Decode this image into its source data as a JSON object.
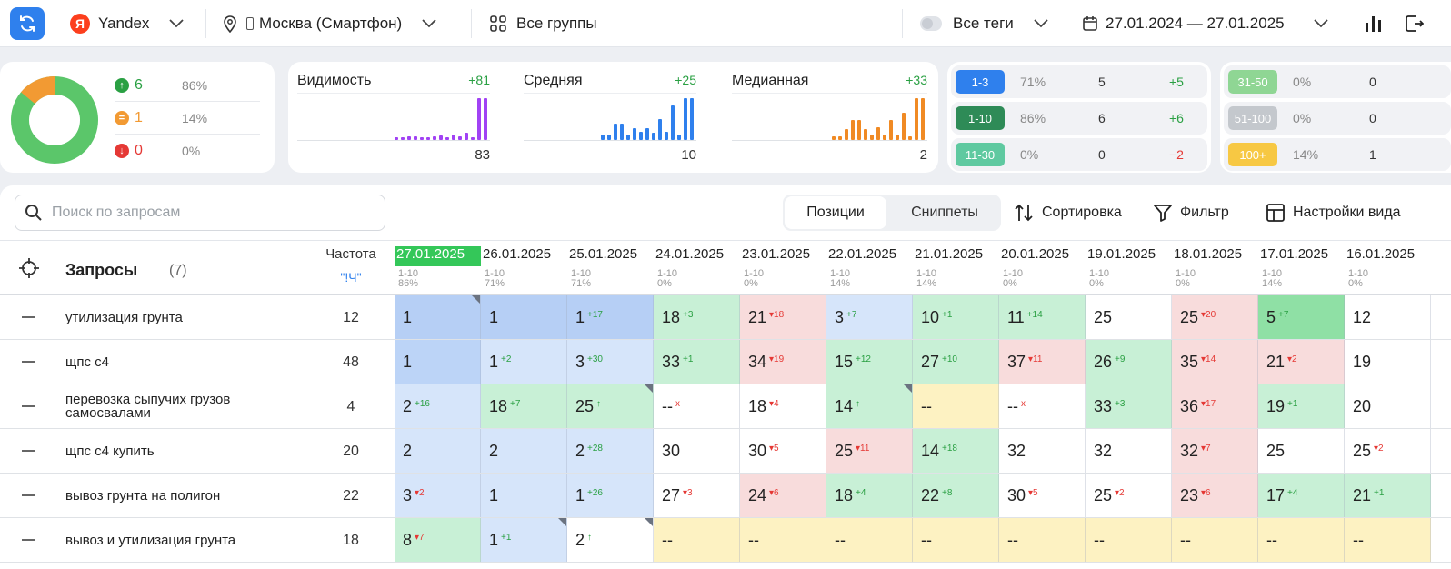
{
  "topbar": {
    "engine": "Yandex",
    "region": "Москва (Смартфон)",
    "groups": "Все группы",
    "tags": "Все теги",
    "date_range": "27.01.2024 — 27.01.2025"
  },
  "summary": {
    "up": {
      "count": "6",
      "pct": "86%"
    },
    "same": {
      "count": "1",
      "pct": "14%"
    },
    "down": {
      "count": "0",
      "pct": "0%"
    },
    "donut": {
      "green_fraction": 0.86,
      "orange_fraction": 0.14
    }
  },
  "metrics": [
    {
      "title": "Видимость",
      "delta": "+81",
      "value": "83",
      "color": "#a142f4",
      "bars": [
        3,
        3,
        4,
        4,
        3,
        3,
        4,
        5,
        3,
        6,
        4,
        8,
        3,
        46,
        46
      ]
    },
    {
      "title": "Средняя",
      "delta": "+25",
      "value": "10",
      "color": "#2f80ed",
      "bars": [
        5,
        5,
        14,
        14,
        5,
        10,
        7,
        10,
        6,
        18,
        7,
        30,
        5,
        36,
        36
      ]
    },
    {
      "title": "Медианная",
      "delta": "+33",
      "value": "2",
      "color": "#f08a24",
      "bars": [
        4,
        4,
        12,
        22,
        22,
        12,
        6,
        14,
        6,
        22,
        6,
        30,
        4,
        46,
        46
      ]
    }
  ],
  "ranges": [
    {
      "label": "1-3",
      "pct": "71%",
      "count": "5",
      "delta": "+5",
      "color": "#2f80ed",
      "delta_color": "#2aa043"
    },
    {
      "label": "1-10",
      "pct": "86%",
      "count": "6",
      "delta": "+6",
      "color": "#2e8b57",
      "delta_color": "#2aa043"
    },
    {
      "label": "11-30",
      "pct": "0%",
      "count": "0",
      "delta": "−2",
      "color": "#5fc9a0",
      "delta_color": "#e53935"
    },
    {
      "label": "31-50",
      "pct": "0%",
      "count": "0",
      "delta": "",
      "color": "#8fd694",
      "delta_color": "#2aa043"
    },
    {
      "label": "51-100",
      "pct": "0%",
      "count": "0",
      "delta": "",
      "color": "#c4c8cd",
      "delta_color": "#2aa043"
    },
    {
      "label": "100+",
      "pct": "14%",
      "count": "1",
      "delta": "",
      "color": "#f7c843",
      "delta_color": "#2aa043"
    }
  ],
  "toolbar": {
    "search_placeholder": "Поиск по запросам",
    "tab_positions": "Позиции",
    "tab_snippets": "Сниппеты",
    "sort": "Сортировка",
    "filter": "Фильтр",
    "view_settings": "Настройки вида"
  },
  "table": {
    "queries_header": "Запросы",
    "queries_count": "(7)",
    "freq_header": "Частота",
    "freq_sub": "\"!Ч\"",
    "dates": [
      {
        "date": "27.01.2025",
        "range": "1-10",
        "pct": "86%"
      },
      {
        "date": "26.01.2025",
        "range": "1-10",
        "pct": "71%"
      },
      {
        "date": "25.01.2025",
        "range": "1-10",
        "pct": "71%"
      },
      {
        "date": "24.01.2025",
        "range": "1-10",
        "pct": "0%"
      },
      {
        "date": "23.01.2025",
        "range": "1-10",
        "pct": "0%"
      },
      {
        "date": "22.01.2025",
        "range": "1-10",
        "pct": "14%"
      },
      {
        "date": "21.01.2025",
        "range": "1-10",
        "pct": "14%"
      },
      {
        "date": "20.01.2025",
        "range": "1-10",
        "pct": "0%"
      },
      {
        "date": "19.01.2025",
        "range": "1-10",
        "pct": "0%"
      },
      {
        "date": "18.01.2025",
        "range": "1-10",
        "pct": "0%"
      },
      {
        "date": "17.01.2025",
        "range": "1-10",
        "pct": "14%"
      },
      {
        "date": "16.01.2025",
        "range": "1-10",
        "pct": "0%"
      }
    ],
    "rows": [
      {
        "query": "утилизация грунта",
        "freq": "12",
        "cells": [
          {
            "v": "1",
            "s": "",
            "t": "",
            "c": "c-blue1",
            "k": 1
          },
          {
            "v": "1",
            "s": "",
            "t": "",
            "c": "c-blue1",
            "k": 0
          },
          {
            "v": "1",
            "s": "+17",
            "t": "g",
            "c": "c-blue1",
            "k": 0
          },
          {
            "v": "18",
            "s": "+3",
            "t": "g",
            "c": "c-green",
            "k": 0
          },
          {
            "v": "21",
            "s": "▾18",
            "t": "r",
            "c": "c-red",
            "k": 0
          },
          {
            "v": "3",
            "s": "+7",
            "t": "g",
            "c": "c-lblue",
            "k": 0
          },
          {
            "v": "10",
            "s": "+1",
            "t": "g",
            "c": "c-green",
            "k": 0
          },
          {
            "v": "11",
            "s": "+14",
            "t": "g",
            "c": "c-green",
            "k": 0
          },
          {
            "v": "25",
            "s": "",
            "t": "",
            "c": "c-white",
            "k": 0
          },
          {
            "v": "25",
            "s": "▾20",
            "t": "r",
            "c": "c-red",
            "k": 0
          },
          {
            "v": "5",
            "s": "+7",
            "t": "g",
            "c": "c-green2",
            "k": 0
          },
          {
            "v": "12",
            "s": "",
            "t": "",
            "c": "c-white",
            "k": 0
          }
        ]
      },
      {
        "query": "щпс с4",
        "freq": "48",
        "cells": [
          {
            "v": "1",
            "s": "",
            "t": "",
            "c": "c-blue",
            "k": 0
          },
          {
            "v": "1",
            "s": "+2",
            "t": "g",
            "c": "c-lblue",
            "k": 0
          },
          {
            "v": "3",
            "s": "+30",
            "t": "g",
            "c": "c-lblue",
            "k": 0
          },
          {
            "v": "33",
            "s": "+1",
            "t": "g",
            "c": "c-green",
            "k": 0
          },
          {
            "v": "34",
            "s": "▾19",
            "t": "r",
            "c": "c-red",
            "k": 0
          },
          {
            "v": "15",
            "s": "+12",
            "t": "g",
            "c": "c-green",
            "k": 0
          },
          {
            "v": "27",
            "s": "+10",
            "t": "g",
            "c": "c-green",
            "k": 0
          },
          {
            "v": "37",
            "s": "▾11",
            "t": "r",
            "c": "c-red",
            "k": 0
          },
          {
            "v": "26",
            "s": "+9",
            "t": "g",
            "c": "c-green",
            "k": 0
          },
          {
            "v": "35",
            "s": "▾14",
            "t": "r",
            "c": "c-red",
            "k": 0
          },
          {
            "v": "21",
            "s": "▾2",
            "t": "r",
            "c": "c-red",
            "k": 0
          },
          {
            "v": "19",
            "s": "",
            "t": "",
            "c": "c-white",
            "k": 0
          }
        ]
      },
      {
        "query": "перевозка сыпучих грузов самосвалами",
        "freq": "4",
        "cells": [
          {
            "v": "2",
            "s": "+16",
            "t": "g",
            "c": "c-lblue",
            "k": 0
          },
          {
            "v": "18",
            "s": "+7",
            "t": "g",
            "c": "c-green",
            "k": 0
          },
          {
            "v": "25",
            "s": "↑",
            "t": "g",
            "c": "c-green",
            "k": 1
          },
          {
            "v": "--",
            "s": "x",
            "t": "r",
            "c": "c-white",
            "k": 0
          },
          {
            "v": "18",
            "s": "▾4",
            "t": "r",
            "c": "c-white",
            "k": 0
          },
          {
            "v": "14",
            "s": "↑",
            "t": "g",
            "c": "c-green",
            "k": 1
          },
          {
            "v": "--",
            "s": "",
            "t": "",
            "c": "c-yellow",
            "k": 0
          },
          {
            "v": "--",
            "s": "x",
            "t": "r",
            "c": "c-white",
            "k": 0
          },
          {
            "v": "33",
            "s": "+3",
            "t": "g",
            "c": "c-green",
            "k": 0
          },
          {
            "v": "36",
            "s": "▾17",
            "t": "r",
            "c": "c-red",
            "k": 0
          },
          {
            "v": "19",
            "s": "+1",
            "t": "g",
            "c": "c-green",
            "k": 0
          },
          {
            "v": "20",
            "s": "",
            "t": "",
            "c": "c-white",
            "k": 0
          }
        ]
      },
      {
        "query": "щпс с4 купить",
        "freq": "20",
        "cells": [
          {
            "v": "2",
            "s": "",
            "t": "",
            "c": "c-lblue",
            "k": 0
          },
          {
            "v": "2",
            "s": "",
            "t": "",
            "c": "c-lblue",
            "k": 0
          },
          {
            "v": "2",
            "s": "+28",
            "t": "g",
            "c": "c-lblue",
            "k": 0
          },
          {
            "v": "30",
            "s": "",
            "t": "",
            "c": "c-white",
            "k": 0
          },
          {
            "v": "30",
            "s": "▾5",
            "t": "r",
            "c": "c-white",
            "k": 0
          },
          {
            "v": "25",
            "s": "▾11",
            "t": "r",
            "c": "c-red",
            "k": 0
          },
          {
            "v": "14",
            "s": "+18",
            "t": "g",
            "c": "c-green",
            "k": 0
          },
          {
            "v": "32",
            "s": "",
            "t": "",
            "c": "c-white",
            "k": 0
          },
          {
            "v": "32",
            "s": "",
            "t": "",
            "c": "c-white",
            "k": 0
          },
          {
            "v": "32",
            "s": "▾7",
            "t": "r",
            "c": "c-red",
            "k": 0
          },
          {
            "v": "25",
            "s": "",
            "t": "",
            "c": "c-white",
            "k": 0
          },
          {
            "v": "25",
            "s": "▾2",
            "t": "r",
            "c": "c-white",
            "k": 0
          }
        ]
      },
      {
        "query": "вывоз грунта на полигон",
        "freq": "22",
        "cells": [
          {
            "v": "3",
            "s": "▾2",
            "t": "r",
            "c": "c-lblue",
            "k": 0
          },
          {
            "v": "1",
            "s": "",
            "t": "",
            "c": "c-lblue",
            "k": 0
          },
          {
            "v": "1",
            "s": "+26",
            "t": "g",
            "c": "c-lblue",
            "k": 0
          },
          {
            "v": "27",
            "s": "▾3",
            "t": "r",
            "c": "c-white",
            "k": 0
          },
          {
            "v": "24",
            "s": "▾6",
            "t": "r",
            "c": "c-red",
            "k": 0
          },
          {
            "v": "18",
            "s": "+4",
            "t": "g",
            "c": "c-green",
            "k": 0
          },
          {
            "v": "22",
            "s": "+8",
            "t": "g",
            "c": "c-green",
            "k": 0
          },
          {
            "v": "30",
            "s": "▾5",
            "t": "r",
            "c": "c-white",
            "k": 0
          },
          {
            "v": "25",
            "s": "▾2",
            "t": "r",
            "c": "c-white",
            "k": 0
          },
          {
            "v": "23",
            "s": "▾6",
            "t": "r",
            "c": "c-red",
            "k": 0
          },
          {
            "v": "17",
            "s": "+4",
            "t": "g",
            "c": "c-green",
            "k": 0
          },
          {
            "v": "21",
            "s": "+1",
            "t": "g",
            "c": "c-green",
            "k": 0
          }
        ]
      },
      {
        "query": "вывоз и утилизация грунта",
        "freq": "18",
        "cells": [
          {
            "v": "8",
            "s": "▾7",
            "t": "r",
            "c": "c-green",
            "k": 0
          },
          {
            "v": "1",
            "s": "+1",
            "t": "g",
            "c": "c-lblue",
            "k": 1
          },
          {
            "v": "2",
            "s": "↑",
            "t": "g",
            "c": "c-white",
            "k": 1
          },
          {
            "v": "--",
            "s": "",
            "t": "",
            "c": "c-yellow",
            "k": 0
          },
          {
            "v": "--",
            "s": "",
            "t": "",
            "c": "c-yellow",
            "k": 0
          },
          {
            "v": "--",
            "s": "",
            "t": "",
            "c": "c-yellow",
            "k": 0
          },
          {
            "v": "--",
            "s": "",
            "t": "",
            "c": "c-yellow",
            "k": 0
          },
          {
            "v": "--",
            "s": "",
            "t": "",
            "c": "c-yellow",
            "k": 0
          },
          {
            "v": "--",
            "s": "",
            "t": "",
            "c": "c-yellow",
            "k": 0
          },
          {
            "v": "--",
            "s": "",
            "t": "",
            "c": "c-yellow",
            "k": 0
          },
          {
            "v": "--",
            "s": "",
            "t": "",
            "c": "c-yellow",
            "k": 0
          },
          {
            "v": "--",
            "s": "",
            "t": "",
            "c": "c-yellow",
            "k": 0
          }
        ]
      }
    ]
  }
}
